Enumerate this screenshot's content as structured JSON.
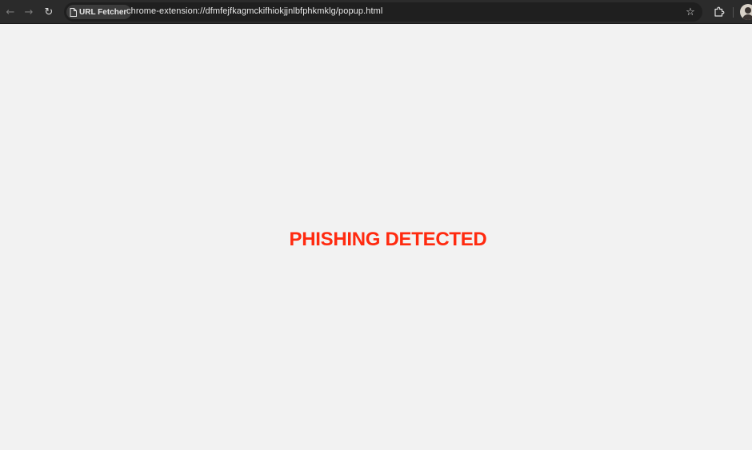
{
  "browser": {
    "back_icon": "arrow-left-icon",
    "forward_icon": "arrow-right-icon",
    "reload_icon": "reload-icon",
    "site_chip": {
      "icon": "document-icon",
      "label": "URL Fetcher"
    },
    "url": "chrome-extension://dfmfejfkagmckifhiokjjnlbfphkmklg/popup.html",
    "bookmark_icon": "star-icon",
    "extensions_icon": "puzzle-icon",
    "profile_icon": "avatar"
  },
  "page": {
    "background_color": "#f2f2f2",
    "message": "PHISHING DETECTED",
    "message_color": "#ff2a0f"
  }
}
